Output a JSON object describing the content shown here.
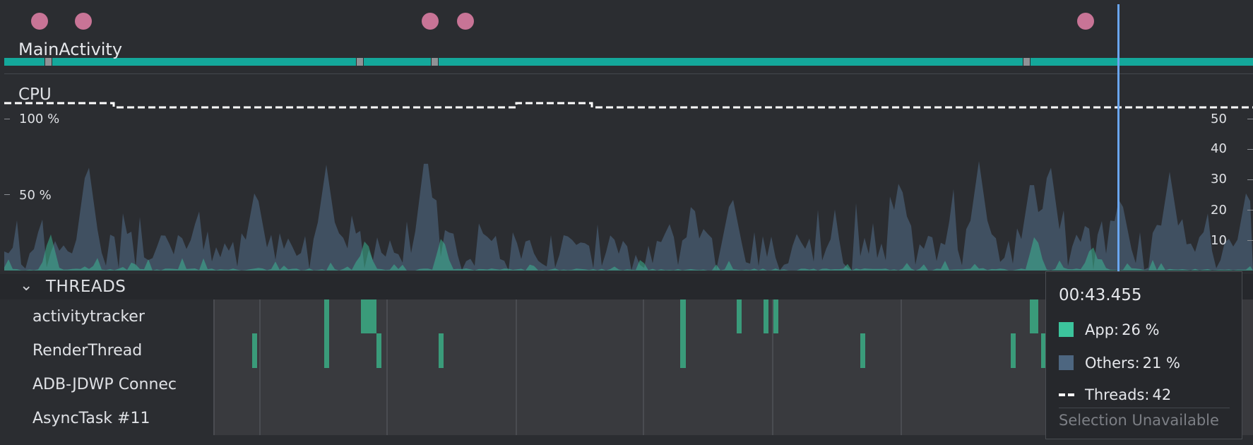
{
  "lifecycle": {
    "activity_label": "MainActivity"
  },
  "cpu": {
    "label": "CPU",
    "left_axis": [
      "100 %",
      "50 %"
    ],
    "right_axis": [
      "50",
      "40",
      "30",
      "20",
      "10"
    ]
  },
  "threads": {
    "header": "THREADS",
    "names": [
      "activitytracker",
      "RenderThread",
      "ADB-JDWP Connec",
      "AsyncTask #11"
    ]
  },
  "tooltip": {
    "time": "00:43.455",
    "app_label": "App:",
    "app_value": "26 %",
    "others_label": "Others:",
    "others_value": "21 %",
    "threads_label": "Threads:",
    "threads_value": "42",
    "unavailable": "Selection Unavailable"
  },
  "colors": {
    "app": "#3cc49c",
    "others": "#4d6680",
    "activity_track": "#14a89b",
    "event_dot": "#c87496",
    "cursor": "#6aa6f1"
  }
}
